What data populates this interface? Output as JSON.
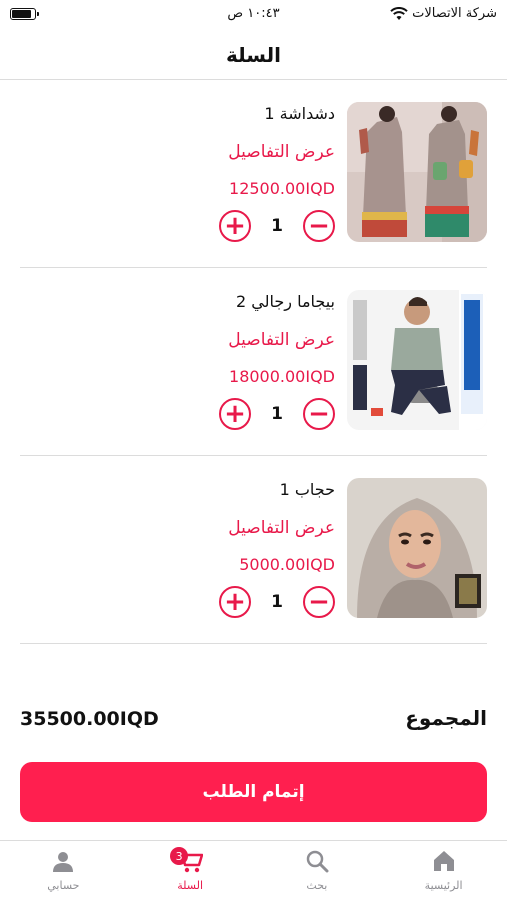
{
  "status": {
    "carrier": "شركة الاتصالات",
    "time": "١٠:٤٣ ص",
    "battery_level": 0.9
  },
  "header": {
    "title": "السلة"
  },
  "cart": {
    "items": [
      {
        "name": "دشداشة 1",
        "details_label": "عرض التفاصيل",
        "price": "12500.00IQD",
        "quantity": "1"
      },
      {
        "name": "بيجاما رجالي 2",
        "details_label": "عرض التفاصيل",
        "price": "18000.00IQD",
        "quantity": "1"
      },
      {
        "name": "حجاب 1",
        "details_label": "عرض التفاصيل",
        "price": "5000.00IQD",
        "quantity": "1"
      }
    ],
    "increase_icon": "plus-circle-icon",
    "decrease_icon": "minus-circle-icon"
  },
  "total": {
    "label": "المجموع",
    "value": "35500.00IQD"
  },
  "checkout": {
    "label": "إتمام الطلب"
  },
  "tabbar": {
    "tabs": [
      {
        "label": "الرئيسية",
        "icon": "home-icon"
      },
      {
        "label": "بحث",
        "icon": "search-icon"
      },
      {
        "label": "السلة",
        "icon": "cart-icon",
        "badge": "3",
        "active": true
      },
      {
        "label": "حسابي",
        "icon": "person-icon"
      }
    ]
  },
  "colors": {
    "accent": "#e8194a",
    "button": "#ff1f4f",
    "inactive_tab": "#8e8e93"
  }
}
